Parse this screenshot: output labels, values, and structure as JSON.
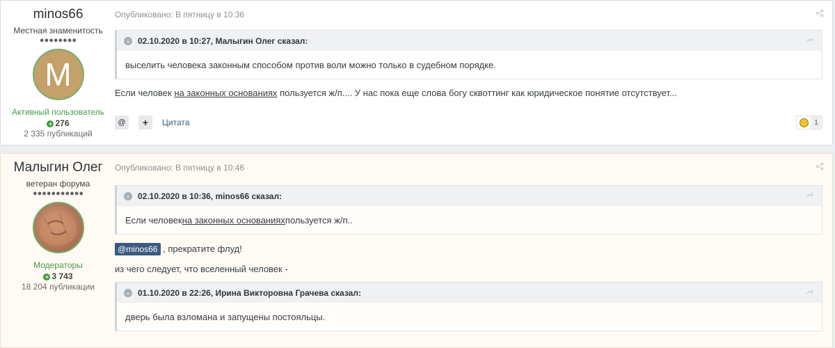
{
  "posts": [
    {
      "author": {
        "name": "minos66",
        "title": "Местная знаменитость",
        "pips": "●●●●●●●●",
        "avatar_letter": "M",
        "group": "Активный пользователь",
        "reputation": "276",
        "posts_count": "2 335 публикаций"
      },
      "meta": "Опубликовано: В пятницу в 10:36",
      "quote": {
        "header": "02.10.2020 в 10:27, Малыгин Олег сказал:",
        "body": "выселить человека законным способом против воли можно только в судебном порядке."
      },
      "text": {
        "before": "Если человек ",
        "link": "на законных основаниях",
        "after": " пользуется ж/п.... У нас пока еще слова богу сквоттинг как юридическое понятие отсутствует..."
      },
      "actions": {
        "mention": "@",
        "multiquote": "+",
        "quote": "Цитата"
      },
      "reaction_count": "1"
    },
    {
      "author": {
        "name": "Малыгин Олег",
        "title": "ветеран форума",
        "pips": "●●●●●●●●●●●",
        "group": "Модераторы",
        "reputation": "3 743",
        "posts_count": "18 204 публикации"
      },
      "meta": "Опубликовано: В пятницу в 10:46",
      "quote": {
        "header": "02.10.2020 в 10:36, minos66 сказал:",
        "body_before": "Если человек ",
        "body_link": "на законных основаниях",
        "body_after": " пользуется ж/п.."
      },
      "mention": "@minos66",
      "mention_text": " , прекратите флуд!",
      "line2": "из чего следует, что вселенный человек -",
      "quote2": {
        "header": "01.10.2020 в 22:26, Ирина Викторовна Грачева сказал:",
        "body": "дверь была взломана и запущены постояльцы."
      }
    }
  ],
  "colors": {
    "accent": "#3b5a7d",
    "moderator_green": "#489a43",
    "highlight_bg": "#fffbf4"
  }
}
